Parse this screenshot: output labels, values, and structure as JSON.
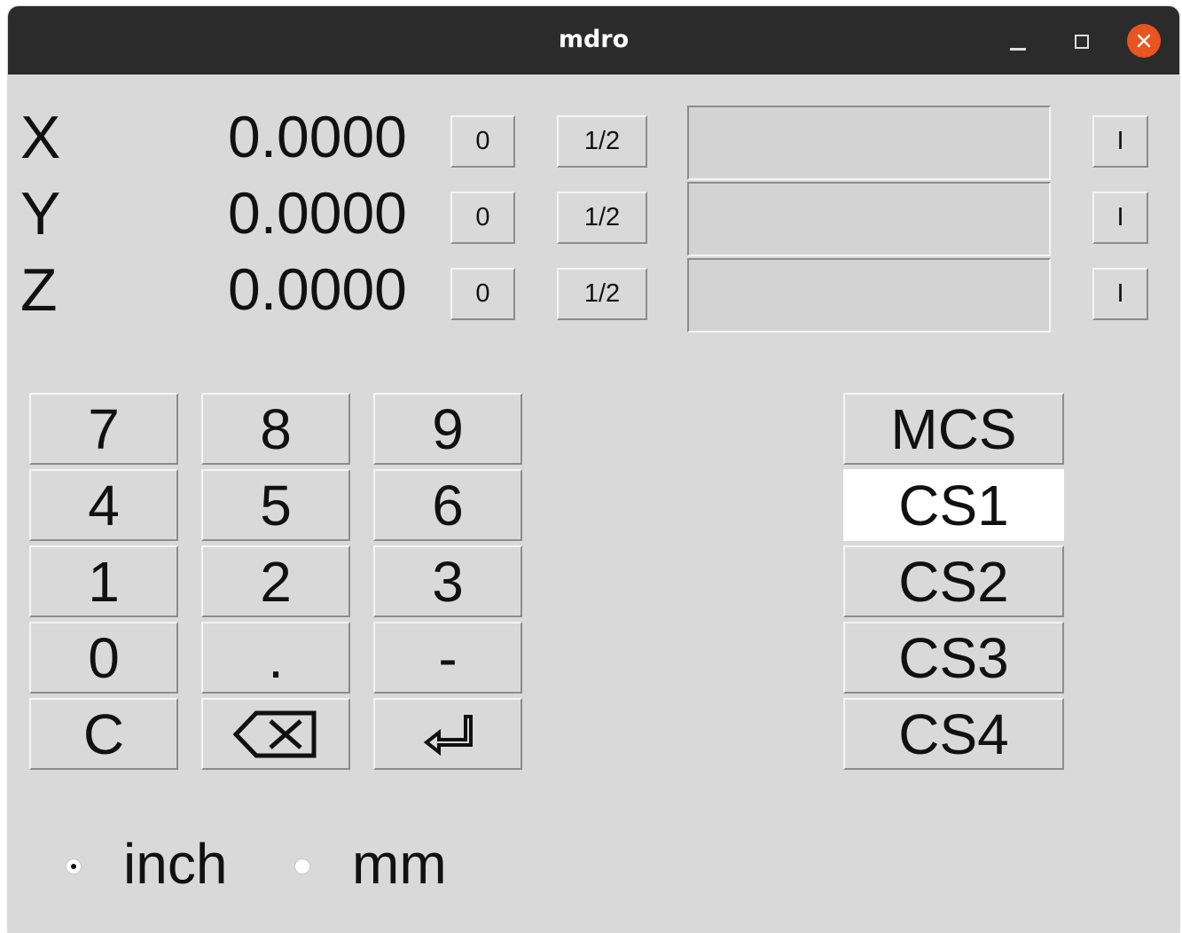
{
  "window": {
    "title": "mdro"
  },
  "axes": [
    {
      "letter": "X",
      "value": "0.0000",
      "zero_label": "0",
      "half_label": "1/2",
      "entry_value": "",
      "incr_label": "I"
    },
    {
      "letter": "Y",
      "value": "0.0000",
      "zero_label": "0",
      "half_label": "1/2",
      "entry_value": "",
      "incr_label": "I"
    },
    {
      "letter": "Z",
      "value": "0.0000",
      "zero_label": "0",
      "half_label": "1/2",
      "entry_value": "",
      "incr_label": "I"
    }
  ],
  "keypad": {
    "keys": [
      "7",
      "8",
      "9",
      "4",
      "5",
      "6",
      "1",
      "2",
      "3",
      "0",
      ".",
      "-",
      "C",
      "⌫",
      "⏎"
    ]
  },
  "coord_systems": {
    "items": [
      "MCS",
      "CS1",
      "CS2",
      "CS3",
      "CS4"
    ],
    "selected": "CS1"
  },
  "units": {
    "inch_label": "inch",
    "mm_label": "mm",
    "selected": "inch"
  },
  "colors": {
    "titlebar": "#2b2b2b",
    "close_button": "#e95420",
    "background": "#d9d9d9",
    "selected_cs": "#ffffff"
  }
}
